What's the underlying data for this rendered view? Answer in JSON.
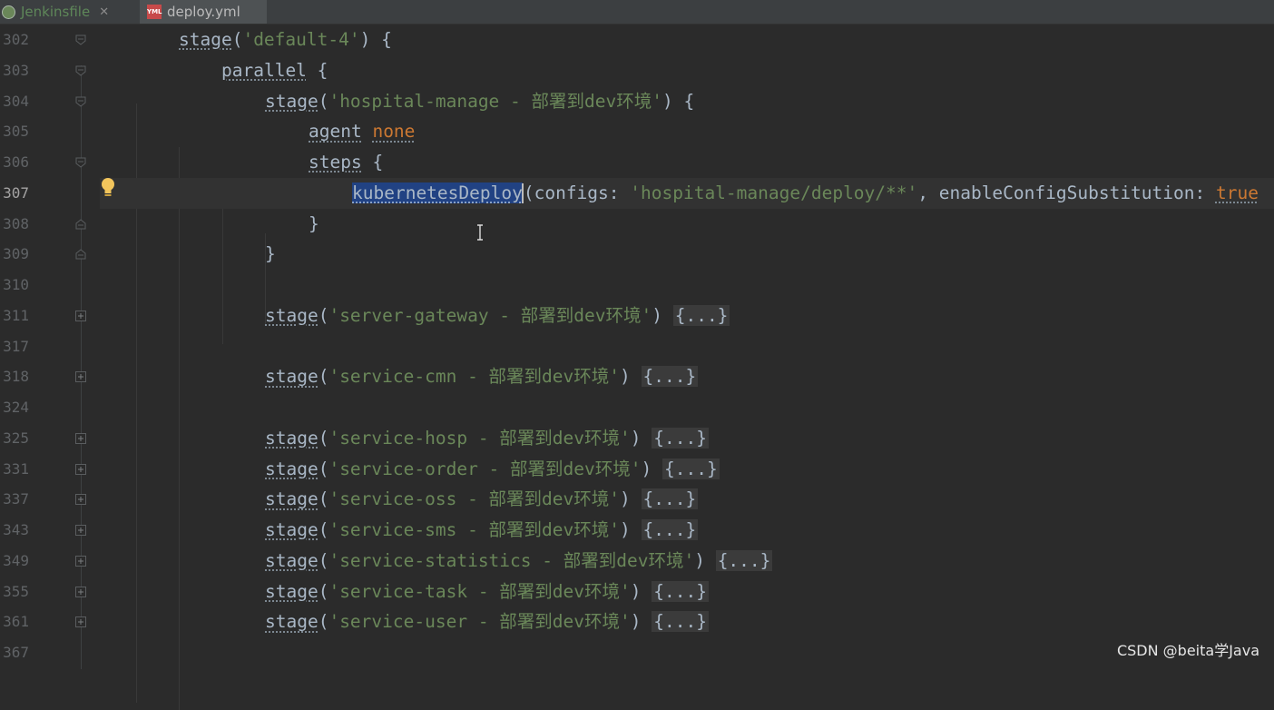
{
  "tabs": [
    {
      "label": "Jenkinsfile",
      "close": "✕",
      "state": "inactive",
      "icon": "jenkins-icon"
    },
    {
      "label": "deploy.yml",
      "badge": "YML",
      "state": "active",
      "icon": "yml-file-icon"
    }
  ],
  "colors": {
    "background": "#2b2b2b",
    "keyword": "#cc7832",
    "string": "#6a8759",
    "text": "#a9b7c6",
    "selection": "#214283",
    "line_number": "#606366"
  },
  "editor": {
    "current_line": "307",
    "lines": [
      {
        "num": "302",
        "fold": "open"
      },
      {
        "num": "303",
        "fold": "open"
      },
      {
        "num": "304",
        "fold": "open"
      },
      {
        "num": "305",
        "fold": "none"
      },
      {
        "num": "306",
        "fold": "open"
      },
      {
        "num": "307",
        "fold": "none"
      },
      {
        "num": "308",
        "fold": "close"
      },
      {
        "num": "309",
        "fold": "close"
      },
      {
        "num": "310",
        "fold": "none"
      },
      {
        "num": "311",
        "fold": "collapsed"
      },
      {
        "num": "317",
        "fold": "none"
      },
      {
        "num": "318",
        "fold": "collapsed"
      },
      {
        "num": "324",
        "fold": "none"
      },
      {
        "num": "325",
        "fold": "collapsed"
      },
      {
        "num": "331",
        "fold": "collapsed"
      },
      {
        "num": "337",
        "fold": "collapsed"
      },
      {
        "num": "343",
        "fold": "collapsed"
      },
      {
        "num": "349",
        "fold": "collapsed"
      },
      {
        "num": "355",
        "fold": "collapsed"
      },
      {
        "num": "361",
        "fold": "collapsed"
      },
      {
        "num": "367",
        "fold": "none"
      }
    ],
    "code": {
      "l302": {
        "kw": "stage",
        "open": "(",
        "str": "'default-4'",
        "close": ") {"
      },
      "l303": {
        "kw": "parallel",
        "close": " {"
      },
      "l304": {
        "kw": "stage",
        "open": "(",
        "str": "'hospital-manage - 部署到dev环境'",
        "close": ") {"
      },
      "l305": {
        "kw": "agent",
        "space": " ",
        "kw2": "none"
      },
      "l306": {
        "kw": "steps",
        "close": " {"
      },
      "l307": {
        "fn": "kubernetesDeploy",
        "open": "(",
        "p1": "configs: ",
        "str": "'hospital-manage/deploy/**'",
        "sep": ", ",
        "p2": "enableConfigSubstitution: ",
        "kw2": "true"
      },
      "l308": {
        "close": "}"
      },
      "l309": {
        "close": "}"
      },
      "collapsed_stages": [
        {
          "kw": "stage",
          "open": "(",
          "str": "'server-gateway - 部署到dev环境'",
          "close": ") ",
          "fold": "{...}"
        },
        {
          "kw": "stage",
          "open": "(",
          "str": "'service-cmn - 部署到dev环境'",
          "close": ") ",
          "fold": "{...}"
        },
        {
          "kw": "stage",
          "open": "(",
          "str": "'service-hosp - 部署到dev环境'",
          "close": ") ",
          "fold": "{...}"
        },
        {
          "kw": "stage",
          "open": "(",
          "str": "'service-order - 部署到dev环境'",
          "close": ") ",
          "fold": "{...}"
        },
        {
          "kw": "stage",
          "open": "(",
          "str": "'service-oss - 部署到dev环境'",
          "close": ") ",
          "fold": "{...}"
        },
        {
          "kw": "stage",
          "open": "(",
          "str": "'service-sms - 部署到dev环境'",
          "close": ") ",
          "fold": "{...}"
        },
        {
          "kw": "stage",
          "open": "(",
          "str": "'service-statistics - 部署到dev环境'",
          "close": ") ",
          "fold": "{...}"
        },
        {
          "kw": "stage",
          "open": "(",
          "str": "'service-task - 部署到dev环境'",
          "close": ") ",
          "fold": "{...}"
        },
        {
          "kw": "stage",
          "open": "(",
          "str": "'service-user - 部署到dev环境'",
          "close": ") ",
          "fold": "{...}"
        }
      ]
    }
  },
  "intention_icon": "lightbulb-icon",
  "watermark": "CSDN @beita学Java"
}
